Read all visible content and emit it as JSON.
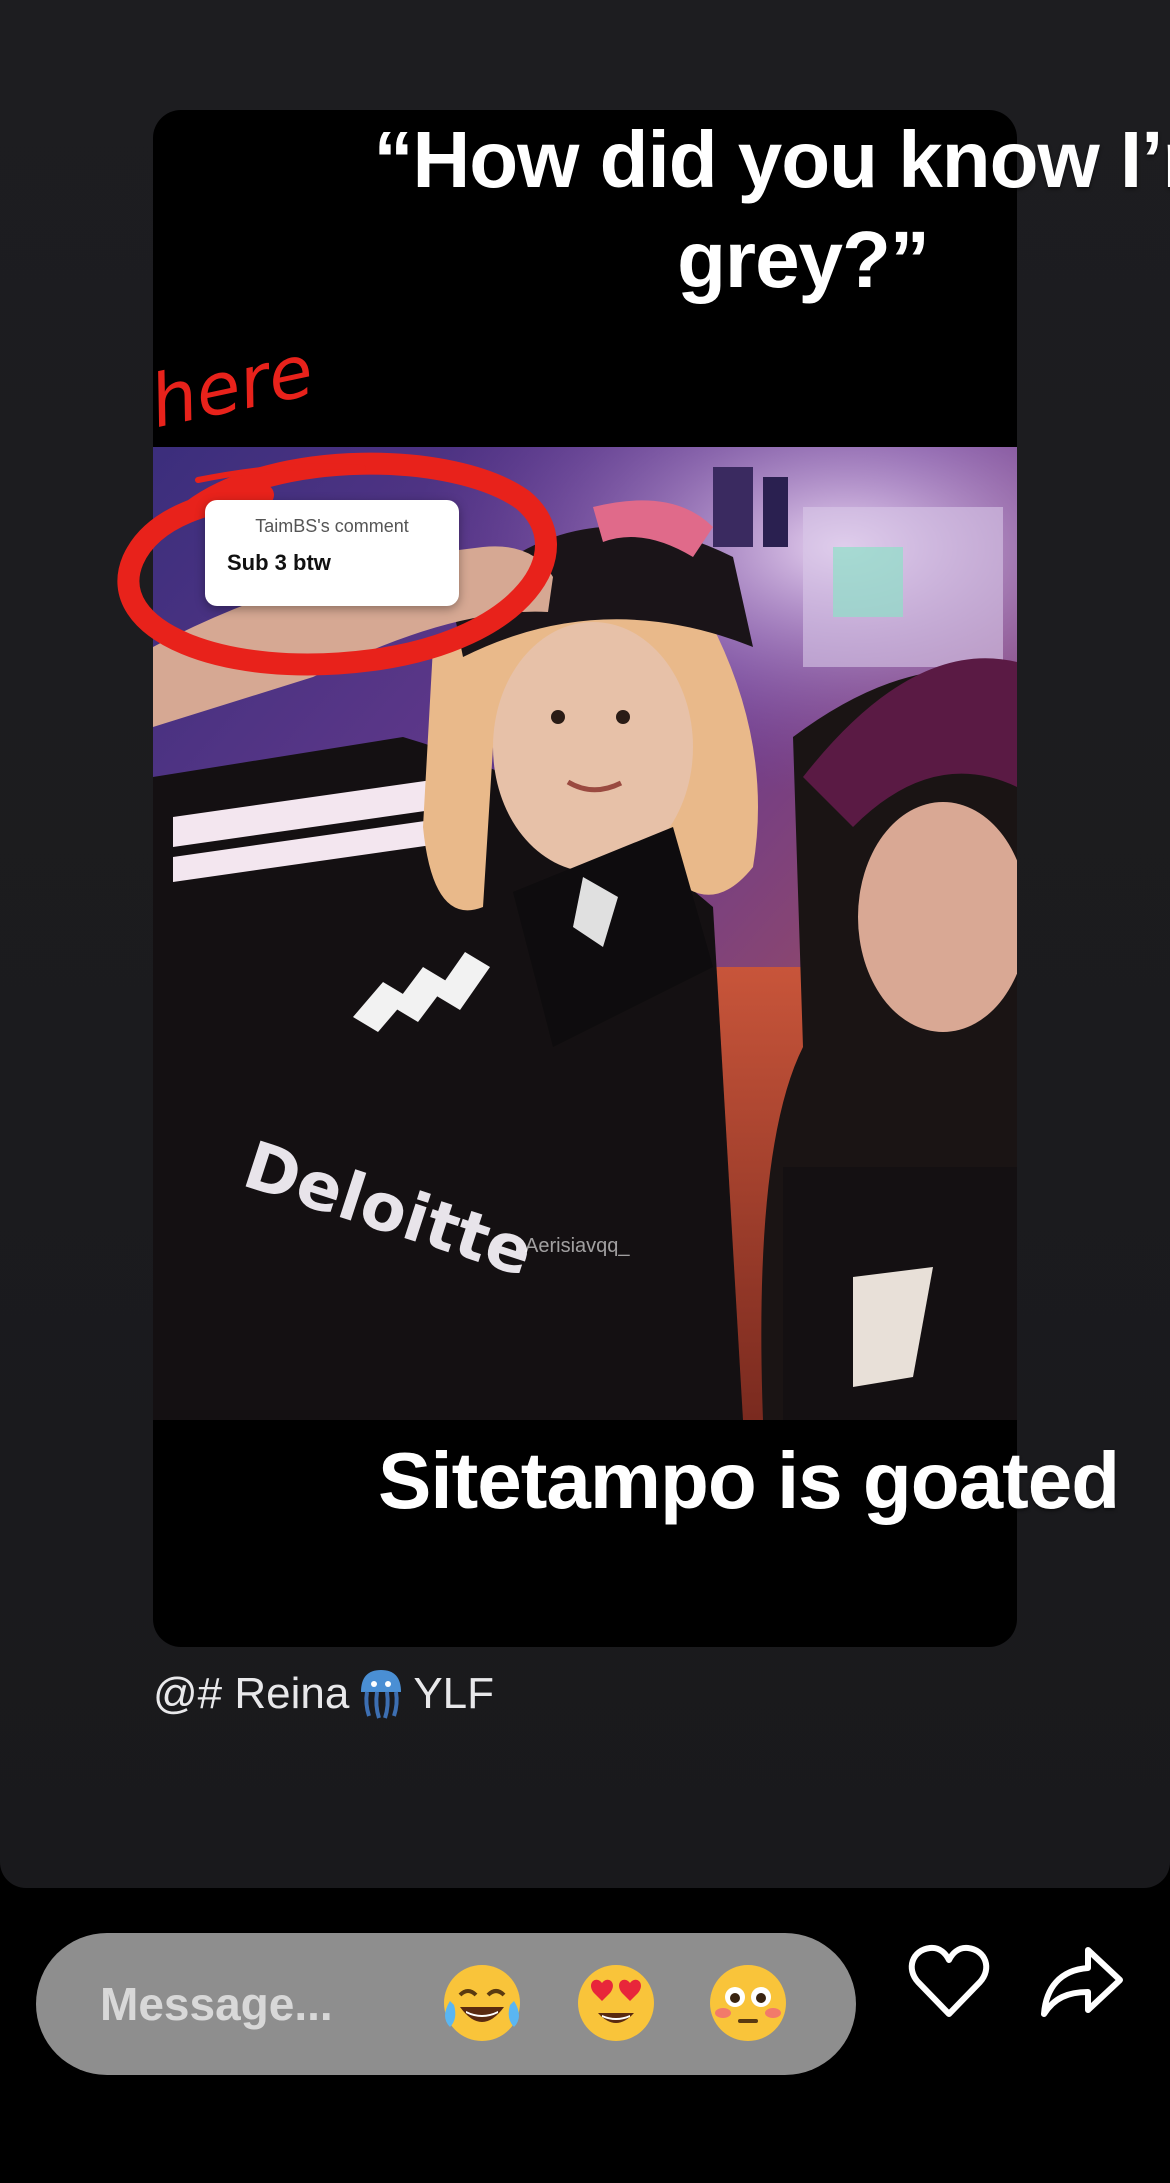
{
  "story": {
    "caption_top": "“How did you know I’m\ngrey?”",
    "caption_bottom": "Sitetampo is goated",
    "annotation_text": "here",
    "comment": {
      "author": "TaimBS's comment",
      "text": "Sub 3 btw"
    },
    "jersey_text": "Deloitte",
    "watermark": "Aerisiavqq_",
    "mention": {
      "prefix": "@# Reina",
      "emoji": "jellyfish",
      "suffix": "YLF"
    }
  },
  "reply_bar": {
    "placeholder": "Message...",
    "quick_reactions": [
      "😂",
      "😍",
      "😳"
    ],
    "like_icon": "heart-icon",
    "share_icon": "share-arrow-icon"
  },
  "colors": {
    "background": "#1c1c1f",
    "annotation_red": "#e8221b",
    "pill": "#8e8e8e"
  }
}
